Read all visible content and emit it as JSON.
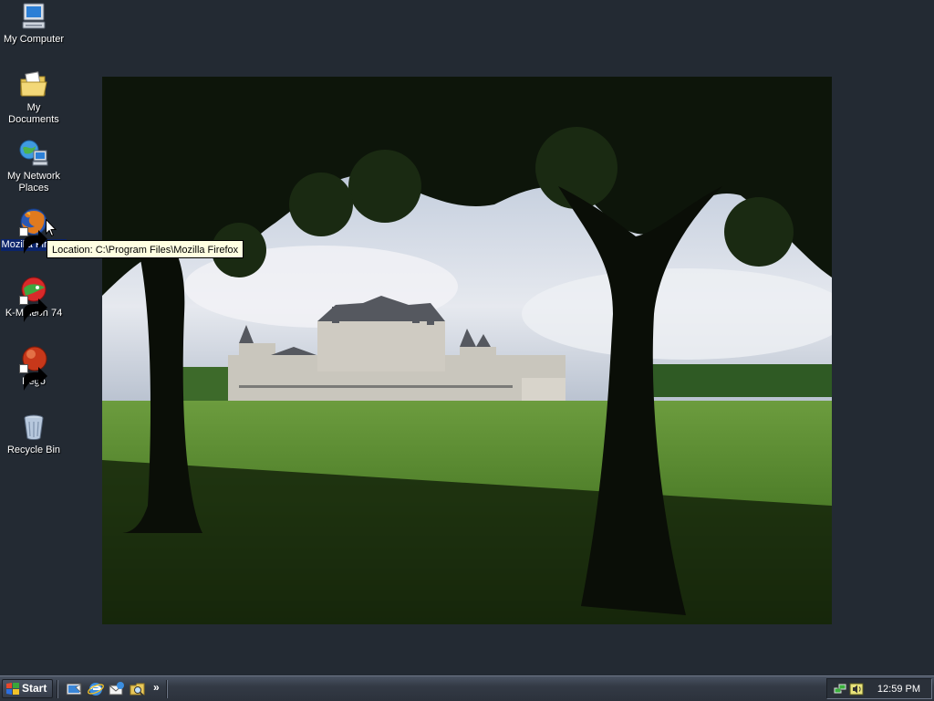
{
  "desktop": {
    "background_color": "#232a33",
    "icons": [
      {
        "label": "My Computer",
        "icon": "computer-icon"
      },
      {
        "label": "My Documents",
        "icon": "folder-documents-icon"
      },
      {
        "label": "My Network Places",
        "icon": "network-places-icon"
      },
      {
        "label": "Mozilla Firefox",
        "icon": "firefox-icon",
        "selected": true
      },
      {
        "label": "K-Meleon 74",
        "icon": "k-meleon-icon"
      },
      {
        "label": "Pego",
        "icon": "pego-icon"
      },
      {
        "label": "Recycle Bin",
        "icon": "recycle-bin-icon"
      }
    ],
    "tooltip": "Location: C:\\Program Files\\Mozilla Firefox",
    "wallpaper": "chateau-wallpaper"
  },
  "taskbar": {
    "start_label": "Start",
    "quick_launch": [
      "show-desktop-icon",
      "internet-explorer-icon",
      "outlook-express-icon",
      "windows-explorer-icon"
    ],
    "more_label": "»",
    "tray_icons": [
      "network-tray-icon",
      "volume-tray-icon"
    ],
    "clock": "12:59 PM"
  }
}
